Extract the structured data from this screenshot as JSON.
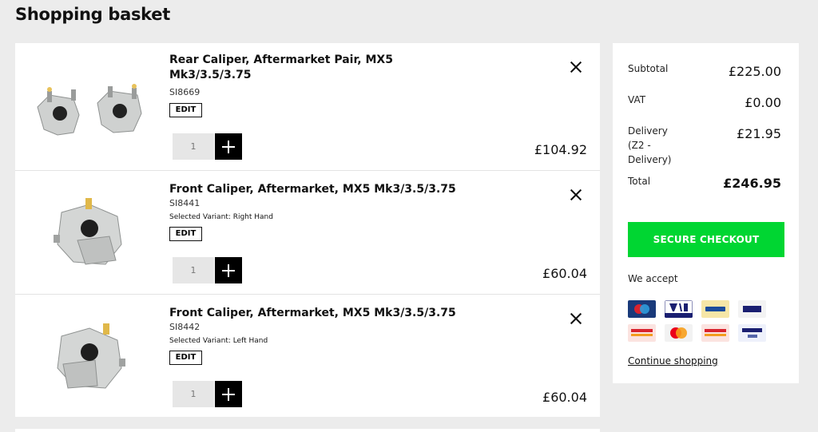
{
  "page": {
    "title": "Shopping basket"
  },
  "basket": {
    "edit_label": "EDIT",
    "items": [
      {
        "name": "Rear Caliper, Aftermarket Pair, MX5 Mk3/3.5/3.75",
        "sku": "SI8669",
        "variant": "",
        "qty": "1",
        "price": "£104.92"
      },
      {
        "name": "Front Caliper, Aftermarket, MX5 Mk3/3.5/3.75",
        "sku": "SI8441",
        "variant": "Selected Variant: Right Hand",
        "qty": "1",
        "price": "£60.04"
      },
      {
        "name": "Front Caliper, Aftermarket, MX5 Mk3/3.5/3.75",
        "sku": "SI8442",
        "variant": "Selected Variant: Left Hand",
        "qty": "1",
        "price": "£60.04"
      }
    ]
  },
  "summary": {
    "subtotal_label": "Subtotal",
    "subtotal_value": "£225.00",
    "vat_label": "VAT",
    "vat_value": "£0.00",
    "delivery_label": "Delivery (Z2 - Delivery)",
    "delivery_value": "£21.95",
    "total_label": "Total",
    "total_value": "£246.95",
    "checkout_label": "SECURE CHECKOUT",
    "accept_label": "We accept",
    "continue_label": "Continue shopping",
    "payment_icons": [
      "maestro-icon",
      "visa-debit-icon",
      "paypal-icon",
      "visa-icon",
      "mastercard-securecode-icon",
      "mastercard-icon",
      "mastercard-securecode-icon",
      "verified-by-visa-icon"
    ]
  },
  "colors": {
    "checkout": "#00d632",
    "background": "#ececec",
    "text": "#111111"
  }
}
